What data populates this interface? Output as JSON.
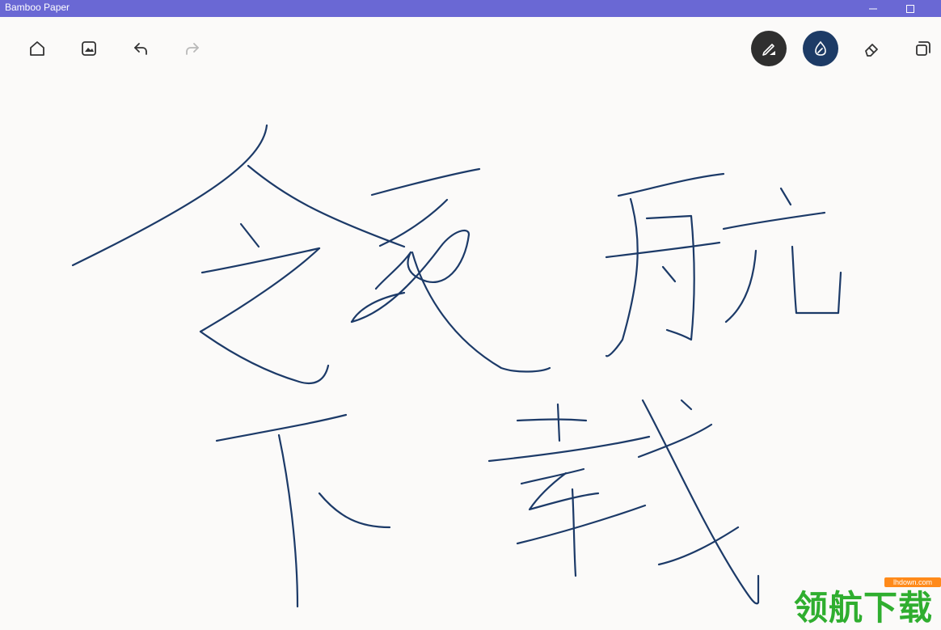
{
  "window": {
    "title": "Bamboo Paper",
    "minimize_icon": "minimize-icon",
    "maximize_icon": "maximize-icon"
  },
  "toolbar": {
    "left": [
      "home-icon",
      "image-icon",
      "undo-icon",
      "redo-icon"
    ],
    "right": [
      "pen-tool-icon",
      "brush-tool-icon",
      "eraser-icon",
      "select-icon"
    ],
    "colors": {
      "pen_bg": "#2f2f2f",
      "brush_bg": "#1d3b66",
      "icon": "#333333",
      "disabled": "#b9b9b9"
    }
  },
  "canvas": {
    "ink_color": "#1c3a68"
  },
  "watermark": {
    "text": "领航下载",
    "url": "lhdown.com"
  }
}
